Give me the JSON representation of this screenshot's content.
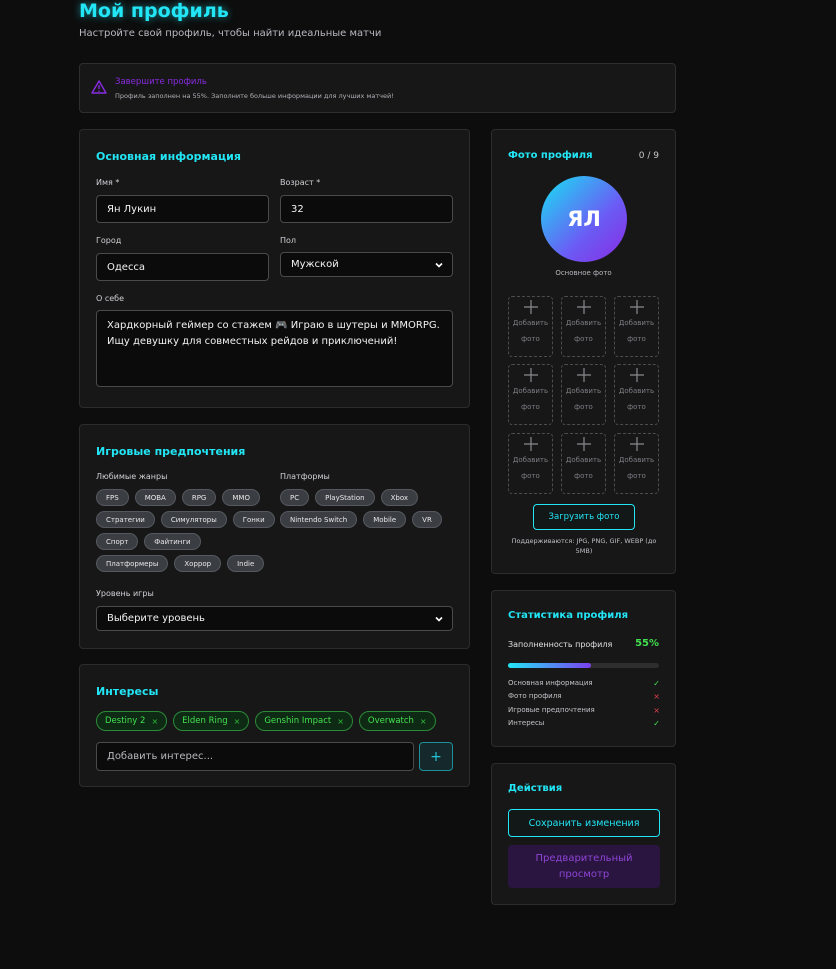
{
  "header": {
    "title": "Мой профиль",
    "subtitle": "Настройте свой профиль, чтобы найти идеальные матчи"
  },
  "alert": {
    "title": "Завершите профиль",
    "text": "Профиль заполнен на 55%. Заполните больше информации для лучших матчей!",
    "icon": "warning-triangle-icon"
  },
  "basic_info": {
    "title": "Основная информация",
    "name_label": "Имя *",
    "name_value": "Ян Лукин",
    "age_label": "Возраст *",
    "age_value": "32",
    "city_label": "Город",
    "city_value": "Одесса",
    "gender_label": "Пол",
    "gender_value": "Мужской",
    "about_label": "О себе",
    "about_value": "Хардкорный геймер со стажем 🎮 Играю в шутеры и MMORPG. Ищу девушку для совместных рейдов и приключений!"
  },
  "gaming": {
    "title": "Игровые предпочтения",
    "genres_label": "Любимые жанры",
    "genres": [
      "FPS",
      "MOBA",
      "RPG",
      "MMO",
      "Стратегии",
      "Симуляторы",
      "Гонки",
      "Спорт",
      "Файтинги",
      "Платформеры",
      "Хоррор",
      "Indie"
    ],
    "platforms_label": "Платформы",
    "platforms": [
      "PC",
      "PlayStation",
      "Xbox",
      "Nintendo Switch",
      "Mobile",
      "VR"
    ],
    "level_label": "Уровень игры",
    "level_value": "Выберите уровень"
  },
  "interests": {
    "title": "Интересы",
    "items": [
      "Destiny 2",
      "Elden Ring",
      "Genshin Impact",
      "Overwatch"
    ],
    "remove_symbol": "×",
    "input_placeholder": "Добавить интерес...",
    "add_symbol": "+"
  },
  "photos": {
    "title": "Фото профиля",
    "count": "0 / 9",
    "initials": "ЯЛ",
    "main_label": "Основное фото",
    "slot_label": "Добавить фото",
    "upload_button": "Загрузить фото",
    "formats": "Поддерживаются: JPG, PNG, GIF, WEBP (до 5MB)"
  },
  "stats": {
    "title": "Статистика профиля",
    "completeness_label": "Заполненность профиля",
    "completeness_value": "55%",
    "completeness_fraction": 0.55,
    "rows": [
      {
        "label": "Основная информация",
        "mark": "✓",
        "done": true
      },
      {
        "label": "Фото профиля",
        "mark": "×",
        "done": false
      },
      {
        "label": "Игровые предпочтения",
        "mark": "×",
        "done": false
      },
      {
        "label": "Интересы",
        "mark": "✓",
        "done": true
      }
    ]
  },
  "actions": {
    "title": "Действия",
    "save_button": "Сохранить изменения",
    "preview_button": "Предварительный просмотр"
  },
  "colors": {
    "accent": "#22e5f5",
    "purple": "#8a2be2",
    "green": "#42e04e",
    "red": "#e04050"
  }
}
